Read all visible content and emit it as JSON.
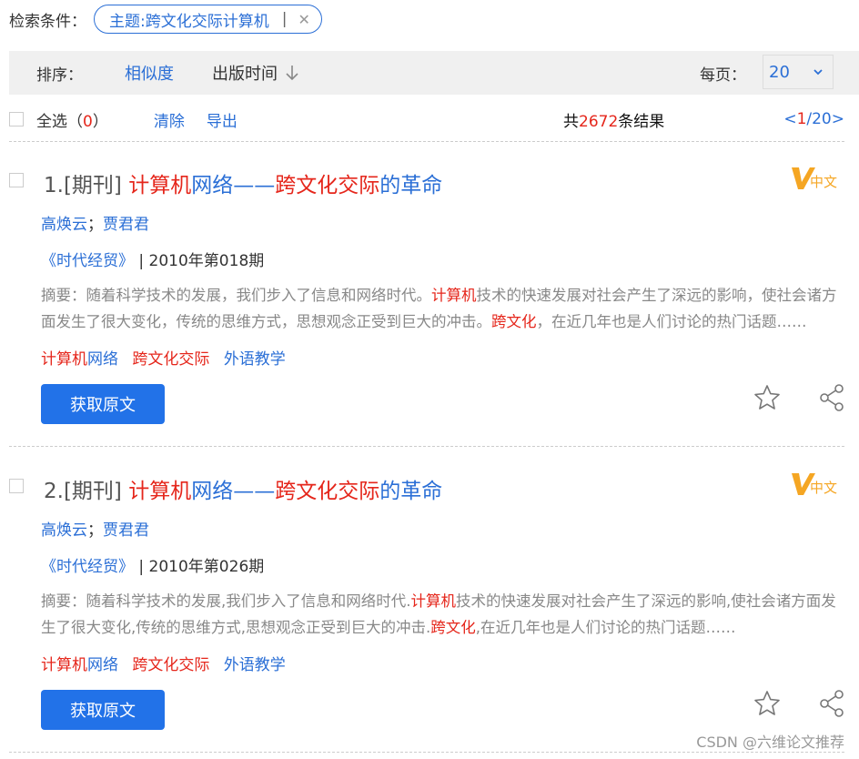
{
  "filter": {
    "label": "检索条件：",
    "chip_text": "主题:跨文化交际计算机",
    "chip_sep": "|",
    "chip_close": "✕"
  },
  "sort": {
    "label": "排序：",
    "options": [
      "相似度",
      "出版时间"
    ],
    "per_page_label": "每页：",
    "per_page_value": "20"
  },
  "actions": {
    "select_all": "全选",
    "selected_count_open": "（",
    "selected_count": "0",
    "selected_count_close": "）",
    "clear": "清除",
    "export": "导出",
    "total_prefix": "共",
    "total": "2672",
    "total_suffix": "条结果",
    "pager_prev": "<",
    "pager_current": "1",
    "pager_sep_total": "/20",
    "pager_next": ">"
  },
  "results": [
    {
      "number": "1.",
      "type": "[期刊]",
      "title_parts": [
        {
          "text": "计算机",
          "hl": true
        },
        {
          "text": "网络",
          "hl": false
        },
        {
          "text": "——",
          "hl": false
        },
        {
          "text": "跨文化交际",
          "hl": true
        },
        {
          "text": "的革命",
          "hl": false
        }
      ],
      "language_badge": "中文",
      "authors": [
        "高焕云",
        "贾君君"
      ],
      "author_sep": "；",
      "journal": "《时代经贸》",
      "issue_sep": "|",
      "issue": "2010年第018期",
      "abstract_parts": [
        {
          "text": "摘要：随着科学技术的发展，我们步入了信息和网络时代。",
          "hl": false
        },
        {
          "text": "计算机",
          "hl": true
        },
        {
          "text": "技术的快速发展对社会产生了深远的影响，使社会诸方面发生了很大变化，传统的思维方式，思想观念正受到巨大的冲击。",
          "hl": false
        },
        {
          "text": "跨文化",
          "hl": true
        },
        {
          "text": "，在近几年也是人们讨论的热门话题……",
          "hl": false
        }
      ],
      "keywords": [
        [
          {
            "text": "计算机",
            "hl": true
          },
          {
            "text": "网络",
            "hl": false
          }
        ],
        [
          {
            "text": "跨文化交际",
            "hl": true
          }
        ],
        [
          {
            "text": "外语教学",
            "hl": false
          }
        ]
      ],
      "button": "获取原文"
    },
    {
      "number": "2.",
      "type": "[期刊]",
      "title_parts": [
        {
          "text": "计算机",
          "hl": true
        },
        {
          "text": "网络",
          "hl": false
        },
        {
          "text": "——",
          "hl": false
        },
        {
          "text": "跨文化交际",
          "hl": true
        },
        {
          "text": "的革命",
          "hl": false
        }
      ],
      "language_badge": "中文",
      "authors": [
        "高焕云",
        "贾君君"
      ],
      "author_sep": "；",
      "journal": "《时代经贸》",
      "issue_sep": "|",
      "issue": "2010年第026期",
      "abstract_parts": [
        {
          "text": "摘要：随着科学技术的发展,我们步入了信息和网络时代.",
          "hl": false
        },
        {
          "text": "计算机",
          "hl": true
        },
        {
          "text": "技术的快速发展对社会产生了深远的影响,使社会诸方面发生了很大变化,传统的思维方式,思想观念正受到巨大的冲击.",
          "hl": false
        },
        {
          "text": "跨文化",
          "hl": true
        },
        {
          "text": ",在近几年也是人们讨论的热门话题……",
          "hl": false
        }
      ],
      "keywords": [
        [
          {
            "text": "计算机",
            "hl": true
          },
          {
            "text": "网络",
            "hl": false
          }
        ],
        [
          {
            "text": "跨文化交际",
            "hl": true
          }
        ],
        [
          {
            "text": "外语教学",
            "hl": false
          }
        ]
      ],
      "button": "获取原文"
    }
  ],
  "watermark": "CSDN @六维论文推荐",
  "colors": {
    "accent": "#2b6fd6",
    "highlight": "#e5261b",
    "button": "#2272e8",
    "badge": "#f5a623"
  }
}
